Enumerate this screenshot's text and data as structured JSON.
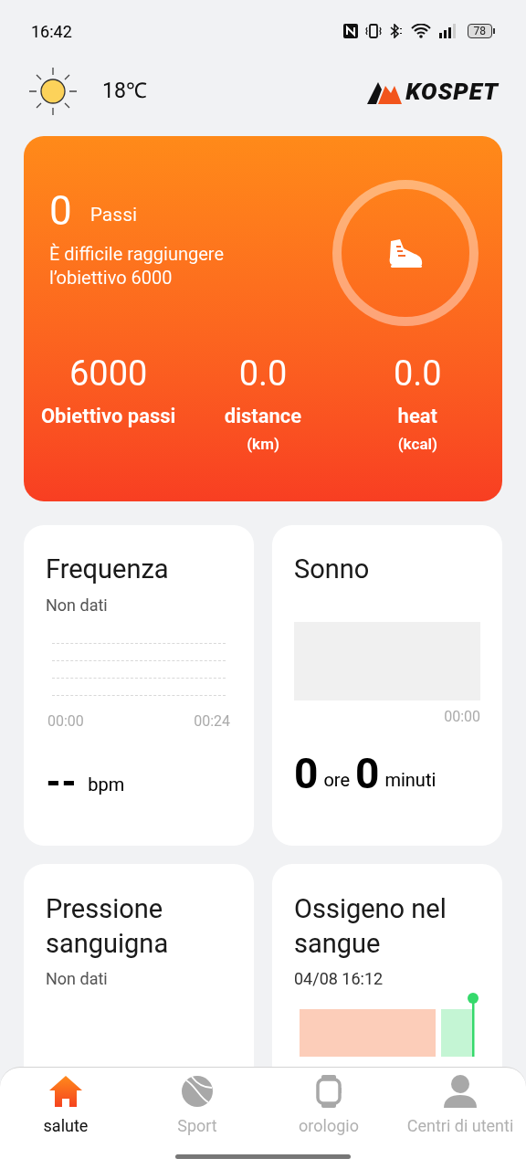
{
  "status_bar": {
    "time": "16:42",
    "battery": "78"
  },
  "header": {
    "temperature": "18℃",
    "logo": "KOSPET"
  },
  "steps_card": {
    "value": "0",
    "unit": "Passi",
    "message": "È difficile raggiungere l’obiettivo 6000",
    "stats": [
      {
        "value": "6000",
        "label": "Obiettivo passi"
      },
      {
        "value": "0.0",
        "label": "distance",
        "unit": "(km)"
      },
      {
        "value": "0.0",
        "label": "heat",
        "unit": "(kcal)"
      }
    ]
  },
  "heart_card": {
    "title": "Frequenza",
    "subtitle": "Non dati",
    "x_labels": [
      "00:00",
      "00:24"
    ],
    "value": "--",
    "unit": "bpm"
  },
  "sleep_card": {
    "title": "Sonno",
    "x_label": "00:00",
    "hours": "0",
    "hours_unit": "ore",
    "minutes": "0",
    "minutes_unit": "minuti"
  },
  "pressure_card": {
    "title": "Pressione sanguigna",
    "subtitle": "Non dati"
  },
  "oxygen_card": {
    "title": "Ossigeno nel sangue",
    "subtitle": "04/08 16:12"
  },
  "tabs": [
    {
      "label": "salute",
      "kind": "home",
      "selected": true
    },
    {
      "label": "Sport",
      "kind": "ball",
      "selected": false
    },
    {
      "label": "orologio",
      "kind": "watch",
      "selected": false
    },
    {
      "label": "Centri di utenti",
      "kind": "user",
      "selected": false
    }
  ]
}
